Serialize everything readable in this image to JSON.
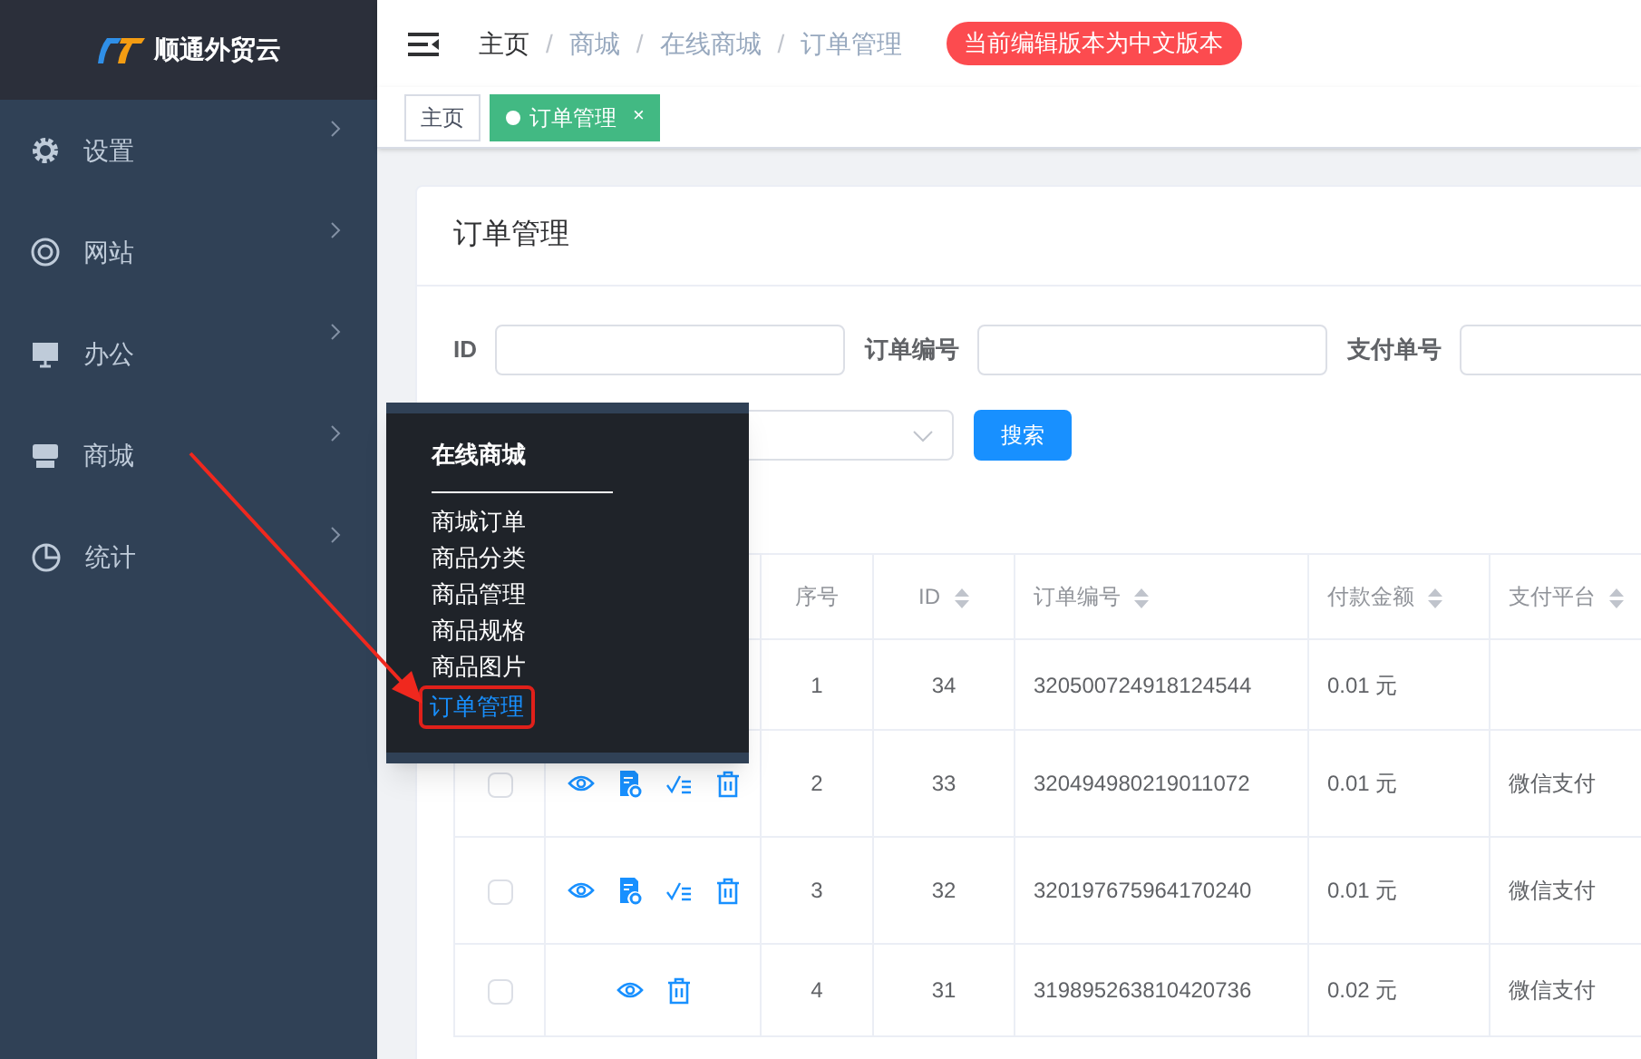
{
  "sidebar": {
    "logo_text": "顺通外贸云",
    "items": [
      {
        "label": "设置",
        "expanded": false
      },
      {
        "label": "网站",
        "expanded": false
      },
      {
        "label": "办公",
        "expanded": false
      },
      {
        "label": "商城",
        "expanded": false
      },
      {
        "label": "统计",
        "expanded": false
      }
    ]
  },
  "breadcrumb": [
    {
      "label": "主页"
    },
    {
      "separator": "/",
      "label": "商城"
    },
    {
      "separator": "/",
      "label": "在线商城"
    },
    {
      "separator": "/",
      "label": "订单管理"
    }
  ],
  "badge": "当前编辑版本为中文版本",
  "tabs": [
    {
      "label": "主页",
      "selected": false
    },
    {
      "label": "订单管理",
      "selected": true,
      "close": "×"
    }
  ],
  "card": {
    "title": "订单管理",
    "filters": [
      {
        "label": "ID"
      },
      {
        "label": "订单编号"
      },
      {
        "label": "支付单号"
      }
    ],
    "search_button": "搜索",
    "table": {
      "columns": [
        {
          "label": "序号",
          "sortable": false
        },
        {
          "label": "ID",
          "sortable": true
        },
        {
          "label": "订单编号",
          "sortable": true
        },
        {
          "label": "付款金额",
          "sortable": true
        },
        {
          "label": "支付平台",
          "sortable": true
        }
      ],
      "rows": [
        {
          "cells": [
            "1",
            "34",
            "320500724918124544",
            "0.01 元",
            ""
          ]
        },
        {
          "checked": false,
          "actions": [
            {
              "kind": "view"
            },
            {
              "kind": "document"
            },
            {
              "kind": "approve"
            },
            {
              "kind": "delete"
            }
          ],
          "cells": [
            "2",
            "33",
            "320494980219011072",
            "0.01 元",
            "微信支付"
          ]
        },
        {
          "checked": false,
          "actions": [
            {
              "kind": "view"
            },
            {
              "kind": "document"
            },
            {
              "kind": "approve"
            },
            {
              "kind": "delete"
            }
          ],
          "cells": [
            "3",
            "32",
            "320197675964170240",
            "0.01 元",
            "微信支付"
          ]
        },
        {
          "checked": false,
          "actions": [
            {
              "kind": "view"
            },
            {
              "kind": "delete"
            }
          ],
          "cells": [
            "4",
            "31",
            "319895263810420736",
            "0.02 元",
            "微信支付"
          ]
        }
      ]
    }
  },
  "popup_menu": {
    "title": "在线商城",
    "items": [
      {
        "label": "商城订单",
        "selected": false
      },
      {
        "label": "商品分类",
        "selected": false
      },
      {
        "label": "商品管理",
        "selected": false
      },
      {
        "label": "商品规格",
        "selected": false
      },
      {
        "label": "商品图片",
        "selected": false
      },
      {
        "label": "订单管理",
        "selected": true
      }
    ]
  }
}
